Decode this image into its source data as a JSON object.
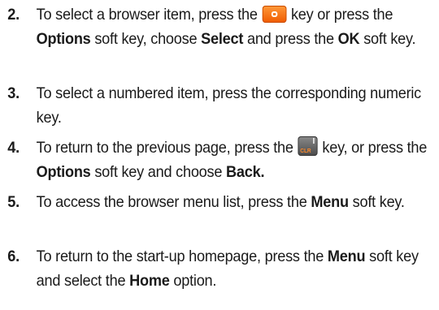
{
  "steps": [
    {
      "number": "2.",
      "t1": "To select a browser item, press the",
      "t2": "key or press the",
      "b1": "Options",
      "t3": "soft key, choose",
      "b2": "Select",
      "t4": "and press the",
      "b3": "OK",
      "t5": "soft key.",
      "key_icon": "ok-key-icon"
    },
    {
      "number": "3.",
      "t1": "To select a numbered item, press the corresponding numeric key."
    },
    {
      "number": "4.",
      "t1": "To return to the previous page, press the",
      "t2": "key, or press the",
      "b1": "Options",
      "t3": "soft key and choose",
      "b2": "Back.",
      "key_icon": "clr-key-icon",
      "key_label_top": "I",
      "key_label_bottom": "CLR"
    },
    {
      "number": "5.",
      "t1": "To access the browser menu list, press the",
      "b1": "Menu",
      "t2": "soft key."
    },
    {
      "number": "6.",
      "t1": "To return to the start-up homepage, press the",
      "b1": "Menu",
      "t2": "soft key and select the",
      "b2": "Home",
      "t3": "option."
    }
  ],
  "colors": {
    "ok_key": "#f26a0a",
    "clr_key": "#5a5a5a",
    "text": "#1a1a1a"
  }
}
